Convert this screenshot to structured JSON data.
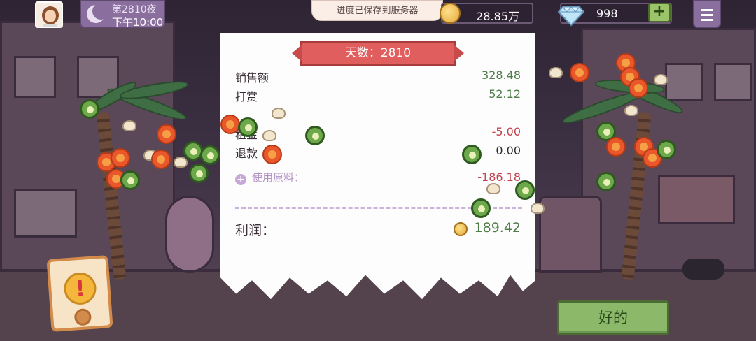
{
  "header": {
    "night_label": "第2810夜",
    "time_label": "下午10:00",
    "toast": "进度已保存到服务器",
    "coins": "28.85万",
    "gems": "998",
    "plus_label": "+"
  },
  "receipt": {
    "day_title": "天数：2810",
    "rows": [
      {
        "label": "销售额",
        "value": "328.48"
      },
      {
        "label": "打赏",
        "value": "52.12"
      },
      {
        "label": "租金",
        "value": "-5.00"
      },
      {
        "label": "退款",
        "value": "0.00"
      }
    ],
    "materials_label": "使用原料：",
    "materials_value": "-186.18",
    "profit_label": "利润：",
    "profit_value": "189.42"
  },
  "buttons": {
    "ok_label": "好的",
    "alert_symbol": "!"
  },
  "colors": {
    "positive": "#4f7d48",
    "negative": "#c2424e",
    "ribbon": "#e05e5e",
    "ok_button": "#8cb86a"
  }
}
